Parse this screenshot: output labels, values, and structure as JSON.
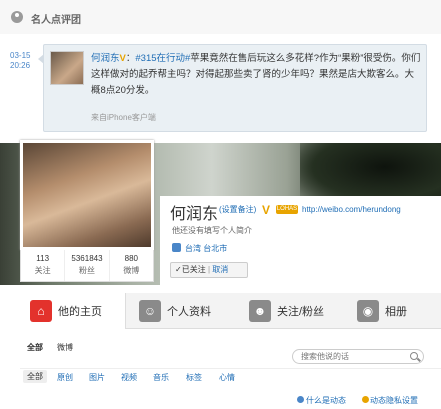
{
  "section": {
    "title": "名人点评团"
  },
  "comment": {
    "time_date": "03-15",
    "time_clock": "20:26",
    "author": "何润东",
    "verified_mark": "V",
    "colon": "：",
    "hashtag": "#315在行动#",
    "text": "苹果竟然在售后玩这么多花样?作为“果粉”很受伤。你们这样做对的起乔帮主吗？对得起那些卖了肾的少年吗？果然是店大欺客么。大概8点20分发。",
    "source": "来自iPhone客户端"
  },
  "profile": {
    "name": "何润东",
    "remark": "(设置备注)",
    "verified_mark": "V",
    "org_badge": "LOHAS",
    "url": "http://weibo.com/herundong",
    "description": "他还没有填写个人简介",
    "location": "台湾 台北市",
    "follow": {
      "check": "✓已关注",
      "sep": "|",
      "cancel": "取消"
    },
    "stats": [
      {
        "value": "113",
        "label": "关注"
      },
      {
        "value": "5361843",
        "label": "粉丝"
      },
      {
        "value": "880",
        "label": "微博"
      }
    ]
  },
  "tabs": [
    {
      "label": "他的主页",
      "icon": "home-icon"
    },
    {
      "label": "个人资料",
      "icon": "person-icon"
    },
    {
      "label": "关注/粉丝",
      "icon": "people-icon"
    },
    {
      "label": "相册",
      "icon": "camera-icon"
    }
  ],
  "filters_top": [
    "全部",
    "微博"
  ],
  "search": {
    "placeholder": "搜索他说的话"
  },
  "filters_type": [
    "全部",
    "原创",
    "图片",
    "视频",
    "音乐",
    "标签",
    "心情"
  ],
  "help": [
    "什么是动态",
    "动态隐私设置"
  ],
  "colors": {
    "link": "#1f6db5",
    "accent": "#e3322c",
    "verified": "#e8a400"
  }
}
